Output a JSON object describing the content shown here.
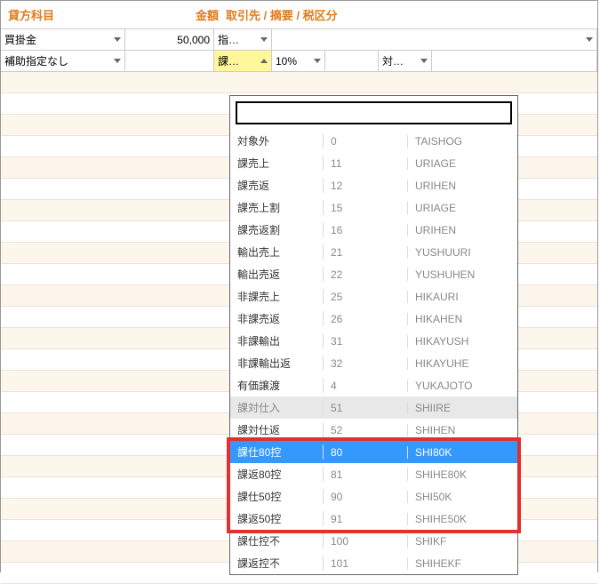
{
  "header": {
    "col1": "貸方科目",
    "col2": "金額",
    "col3": "取引先 / 摘要 / 税区分"
  },
  "row1": {
    "account": "買掛金",
    "amount": "50,000",
    "partner": "指…"
  },
  "row2": {
    "aux": "補助指定なし",
    "tax": "課…",
    "rate": "10%",
    "target": "対…"
  },
  "dropdown": {
    "search_placeholder": "",
    "items": [
      {
        "name": "対象外",
        "code": "0",
        "roman": "TAISHOG"
      },
      {
        "name": "課売上",
        "code": "11",
        "roman": "URIAGE"
      },
      {
        "name": "課売返",
        "code": "12",
        "roman": "URIHEN"
      },
      {
        "name": "課売上割",
        "code": "15",
        "roman": "URIAGE"
      },
      {
        "name": "課売返割",
        "code": "16",
        "roman": "URIHEN"
      },
      {
        "name": "輸出売上",
        "code": "21",
        "roman": "YUSHUURI"
      },
      {
        "name": "輸出売返",
        "code": "22",
        "roman": "YUSHUHEN"
      },
      {
        "name": "非課売上",
        "code": "25",
        "roman": "HIKAURI"
      },
      {
        "name": "非課売返",
        "code": "26",
        "roman": "HIKAHEN"
      },
      {
        "name": "非課輸出",
        "code": "31",
        "roman": "HIKAYUSH"
      },
      {
        "name": "非課輸出返",
        "code": "32",
        "roman": "HIKAYUHE"
      },
      {
        "name": "有価譲渡",
        "code": "4",
        "roman": "YUKAJOTO"
      },
      {
        "name": "課対仕入",
        "code": "51",
        "roman": "SHIIRE"
      },
      {
        "name": "課対仕返",
        "code": "52",
        "roman": "SHIHEN"
      },
      {
        "name": "課仕80控",
        "code": "80",
        "roman": "SHI80K"
      },
      {
        "name": "課返80控",
        "code": "81",
        "roman": "SHIHE80K"
      },
      {
        "name": "課仕50控",
        "code": "90",
        "roman": "SHI50K"
      },
      {
        "name": "課返50控",
        "code": "91",
        "roman": "SHIHE50K"
      },
      {
        "name": "課仕控不",
        "code": "100",
        "roman": "SHIKF"
      },
      {
        "name": "課返控不",
        "code": "101",
        "roman": "SHIHEKF"
      }
    ],
    "gray_index": 12,
    "selected_index": 14
  }
}
